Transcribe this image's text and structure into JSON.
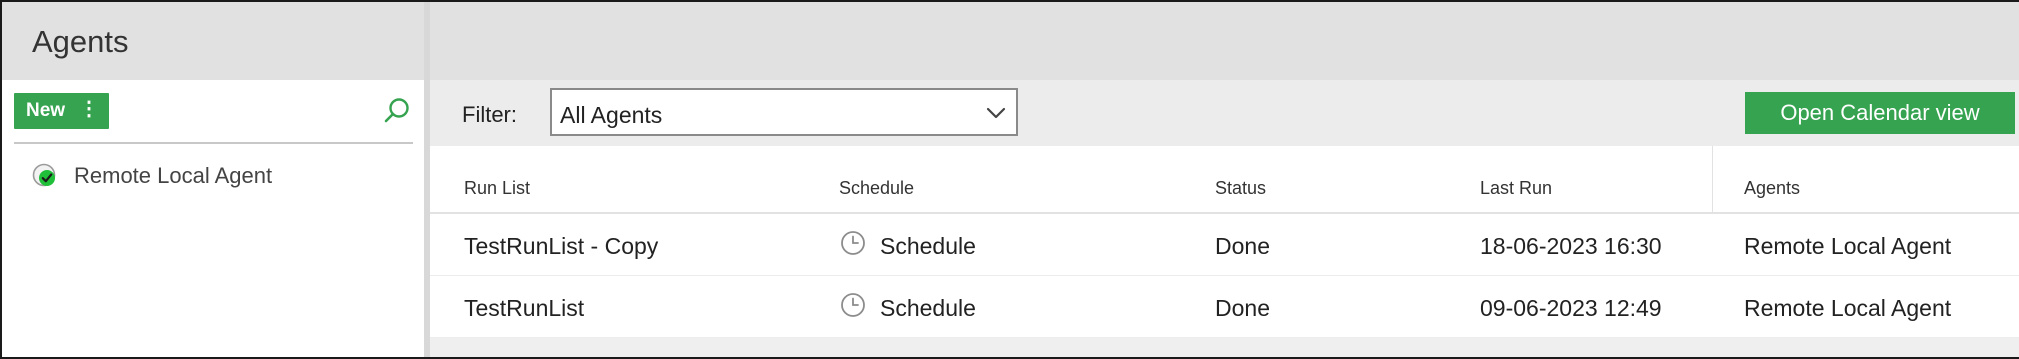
{
  "sidebar": {
    "title": "Agents",
    "new_button_label": "New",
    "new_button_more": "⋮",
    "items": [
      {
        "label": "Remote Local Agent",
        "status": "online",
        "status_color": "#1fbf3a"
      }
    ]
  },
  "filter": {
    "label": "Filter:",
    "selected": "All Agents"
  },
  "toolbar": {
    "calendar_button_label": "Open Calendar view"
  },
  "table": {
    "headers": {
      "run_list": "Run List",
      "schedule": "Schedule",
      "status": "Status",
      "last_run": "Last Run",
      "agents": "Agents"
    },
    "rows": [
      {
        "run_list": "TestRunList - Copy",
        "schedule": "Schedule",
        "status": "Done",
        "last_run": "18-06-2023 16:30",
        "agents": "Remote Local Agent"
      },
      {
        "run_list": "TestRunList",
        "schedule": "Schedule",
        "status": "Done",
        "last_run": "09-06-2023 12:49",
        "agents": "Remote Local Agent"
      }
    ]
  },
  "colors": {
    "accent_green": "#35a34f",
    "header_gray": "#e1e1e1"
  }
}
